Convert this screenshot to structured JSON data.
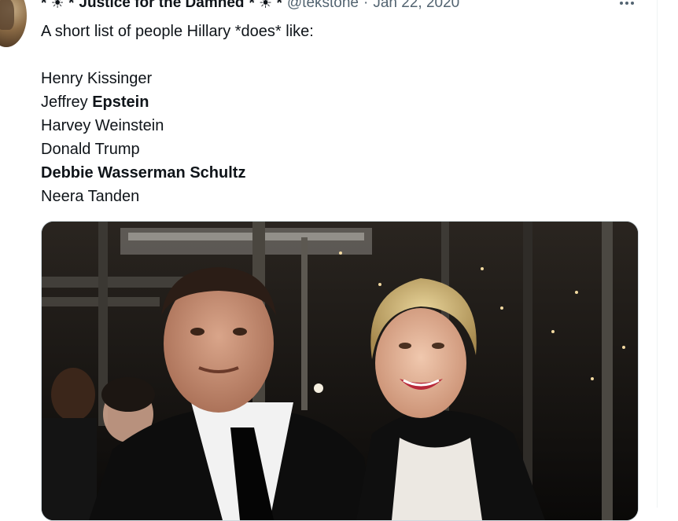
{
  "tweet": {
    "author": {
      "display_name": "Justice for the Damned",
      "name_decoration_left": "* ☀ *",
      "name_decoration_right": "* ☀ *",
      "handle": "@tekstone",
      "separator": "·",
      "date": "Jan 22, 2020"
    },
    "text_lines": [
      {
        "parts": [
          {
            "t": "A short list of people Hillary *does* like:",
            "bold": false
          }
        ]
      },
      {
        "parts": []
      },
      {
        "parts": [
          {
            "t": "Henry Kissinger",
            "bold": false
          }
        ]
      },
      {
        "parts": [
          {
            "t": "Jeffrey ",
            "bold": false
          },
          {
            "t": "Epstein",
            "bold": true
          }
        ]
      },
      {
        "parts": [
          {
            "t": "Harvey Weinstein",
            "bold": false
          }
        ]
      },
      {
        "parts": [
          {
            "t": "Donald Trump",
            "bold": false
          }
        ]
      },
      {
        "parts": [
          {
            "t": "Debbie Wasserman Schultz",
            "bold": true
          }
        ]
      },
      {
        "parts": [
          {
            "t": "Neera Tanden",
            "bold": false
          }
        ]
      }
    ],
    "media": {
      "kind": "photo",
      "icon": "photo-image"
    }
  },
  "icons": {
    "more": "more-horizontal-icon",
    "avatar": "avatar"
  },
  "colors": {
    "text_primary": "#0f1419",
    "text_secondary": "#536471",
    "border": "#cfd9de"
  }
}
